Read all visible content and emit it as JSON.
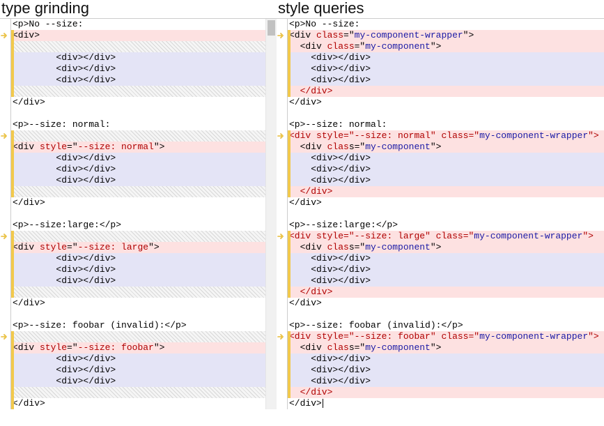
{
  "left": {
    "title": "type grinding",
    "lines": [
      {
        "hl": "",
        "bar": false,
        "arrow": false,
        "tokens": [
          {
            "t": "<p>No --size:",
            "c": "t-blk"
          }
        ]
      },
      {
        "hl": "hl-red",
        "bar": true,
        "arrow": true,
        "tokens": [
          {
            "t": "<div>",
            "c": "t-blk"
          }
        ]
      },
      {
        "hl": "hl-hatch",
        "bar": true,
        "arrow": false,
        "tokens": [
          {
            "t": "",
            "c": ""
          }
        ]
      },
      {
        "hl": "hl-blue",
        "bar": true,
        "arrow": false,
        "tokens": [
          {
            "t": "        <div></div>",
            "c": "t-blk"
          }
        ]
      },
      {
        "hl": "hl-blue",
        "bar": true,
        "arrow": false,
        "tokens": [
          {
            "t": "        <div></div>",
            "c": "t-blk"
          }
        ]
      },
      {
        "hl": "hl-blue",
        "bar": true,
        "arrow": false,
        "tokens": [
          {
            "t": "        <div></div>",
            "c": "t-blk"
          }
        ]
      },
      {
        "hl": "hl-hatch",
        "bar": true,
        "arrow": false,
        "tokens": [
          {
            "t": "",
            "c": ""
          }
        ]
      },
      {
        "hl": "",
        "bar": false,
        "arrow": false,
        "tokens": [
          {
            "t": "</div>",
            "c": "t-blk"
          }
        ]
      },
      {
        "hl": "",
        "bar": false,
        "arrow": false,
        "tokens": [
          {
            "t": "",
            "c": ""
          }
        ]
      },
      {
        "hl": "",
        "bar": false,
        "arrow": false,
        "tokens": [
          {
            "t": "<p>--size: normal:",
            "c": "t-blk"
          }
        ]
      },
      {
        "hl": "hl-hatch",
        "bar": true,
        "arrow": true,
        "tokens": [
          {
            "t": "",
            "c": ""
          }
        ]
      },
      {
        "hl": "hl-red",
        "bar": true,
        "arrow": false,
        "tokens": [
          {
            "t": "<div ",
            "c": "t-blk"
          },
          {
            "t": "style",
            "c": "t-attr"
          },
          {
            "t": "=\"",
            "c": "t-blk"
          },
          {
            "t": "--size: normal",
            "c": "t-attr"
          },
          {
            "t": "\">",
            "c": "t-blk"
          }
        ]
      },
      {
        "hl": "hl-blue",
        "bar": true,
        "arrow": false,
        "tokens": [
          {
            "t": "        <div></div>",
            "c": "t-blk"
          }
        ]
      },
      {
        "hl": "hl-blue",
        "bar": true,
        "arrow": false,
        "tokens": [
          {
            "t": "        <div></div>",
            "c": "t-blk"
          }
        ]
      },
      {
        "hl": "hl-blue",
        "bar": true,
        "arrow": false,
        "tokens": [
          {
            "t": "        <div></div>",
            "c": "t-blk"
          }
        ]
      },
      {
        "hl": "hl-hatch",
        "bar": true,
        "arrow": false,
        "tokens": [
          {
            "t": "",
            "c": ""
          }
        ]
      },
      {
        "hl": "",
        "bar": false,
        "arrow": false,
        "tokens": [
          {
            "t": "</div>",
            "c": "t-blk"
          }
        ]
      },
      {
        "hl": "",
        "bar": false,
        "arrow": false,
        "tokens": [
          {
            "t": "",
            "c": ""
          }
        ]
      },
      {
        "hl": "",
        "bar": false,
        "arrow": false,
        "tokens": [
          {
            "t": "<p>--size:large:</p>",
            "c": "t-blk"
          }
        ]
      },
      {
        "hl": "hl-hatch",
        "bar": true,
        "arrow": true,
        "tokens": [
          {
            "t": "",
            "c": ""
          }
        ]
      },
      {
        "hl": "hl-red",
        "bar": true,
        "arrow": false,
        "tokens": [
          {
            "t": "<div ",
            "c": "t-blk"
          },
          {
            "t": "style",
            "c": "t-attr"
          },
          {
            "t": "=\"",
            "c": "t-blk"
          },
          {
            "t": "--size: large",
            "c": "t-attr"
          },
          {
            "t": "\">",
            "c": "t-blk"
          }
        ]
      },
      {
        "hl": "hl-blue",
        "bar": true,
        "arrow": false,
        "tokens": [
          {
            "t": "        <div></div>",
            "c": "t-blk"
          }
        ]
      },
      {
        "hl": "hl-blue",
        "bar": true,
        "arrow": false,
        "tokens": [
          {
            "t": "        <div></div>",
            "c": "t-blk"
          }
        ]
      },
      {
        "hl": "hl-blue",
        "bar": true,
        "arrow": false,
        "tokens": [
          {
            "t": "        <div></div>",
            "c": "t-blk"
          }
        ]
      },
      {
        "hl": "hl-hatch",
        "bar": true,
        "arrow": false,
        "tokens": [
          {
            "t": "",
            "c": ""
          }
        ]
      },
      {
        "hl": "",
        "bar": false,
        "arrow": false,
        "tokens": [
          {
            "t": "</div>",
            "c": "t-blk"
          }
        ]
      },
      {
        "hl": "",
        "bar": false,
        "arrow": false,
        "tokens": [
          {
            "t": "",
            "c": ""
          }
        ]
      },
      {
        "hl": "",
        "bar": false,
        "arrow": false,
        "tokens": [
          {
            "t": "<p>--size: foobar (invalid):</p>",
            "c": "t-blk"
          }
        ]
      },
      {
        "hl": "hl-hatch",
        "bar": true,
        "arrow": true,
        "tokens": [
          {
            "t": "",
            "c": ""
          }
        ]
      },
      {
        "hl": "hl-red",
        "bar": true,
        "arrow": false,
        "tokens": [
          {
            "t": "<div ",
            "c": "t-blk"
          },
          {
            "t": "style",
            "c": "t-attr"
          },
          {
            "t": "=\"",
            "c": "t-blk"
          },
          {
            "t": "--size: foobar",
            "c": "t-attr"
          },
          {
            "t": "\">",
            "c": "t-blk"
          }
        ]
      },
      {
        "hl": "hl-blue",
        "bar": true,
        "arrow": false,
        "tokens": [
          {
            "t": "        <div></div>",
            "c": "t-blk"
          }
        ]
      },
      {
        "hl": "hl-blue",
        "bar": true,
        "arrow": false,
        "tokens": [
          {
            "t": "        <div></div>",
            "c": "t-blk"
          }
        ]
      },
      {
        "hl": "hl-blue",
        "bar": true,
        "arrow": false,
        "tokens": [
          {
            "t": "        <div></div>",
            "c": "t-blk"
          }
        ]
      },
      {
        "hl": "hl-hatch",
        "bar": true,
        "arrow": false,
        "tokens": [
          {
            "t": "",
            "c": ""
          }
        ]
      },
      {
        "hl": "",
        "bar": true,
        "arrow": false,
        "tokens": [
          {
            "t": "</div>",
            "c": "t-blk"
          }
        ]
      }
    ]
  },
  "right": {
    "title": "style queries",
    "lines": [
      {
        "hl": "",
        "bar": false,
        "arrow": false,
        "tokens": [
          {
            "t": "<p>No --size:",
            "c": "t-blk"
          }
        ]
      },
      {
        "hl": "hl-red",
        "bar": true,
        "arrow": true,
        "tokens": [
          {
            "t": "<div ",
            "c": "t-blk"
          },
          {
            "t": "class",
            "c": "t-attr"
          },
          {
            "t": "=\"",
            "c": "t-blk"
          },
          {
            "t": "my-component-wrapper",
            "c": "t-str"
          },
          {
            "t": "\">",
            "c": "t-blk"
          }
        ]
      },
      {
        "hl": "hl-red",
        "bar": true,
        "arrow": false,
        "tokens": [
          {
            "t": "  <div ",
            "c": "t-blk"
          },
          {
            "t": "class",
            "c": "t-attr"
          },
          {
            "t": "=\"",
            "c": "t-blk"
          },
          {
            "t": "my-component",
            "c": "t-str"
          },
          {
            "t": "\">",
            "c": "t-blk"
          }
        ]
      },
      {
        "hl": "hl-blue",
        "bar": true,
        "arrow": false,
        "tokens": [
          {
            "t": "    <div></div>",
            "c": "t-blk"
          }
        ]
      },
      {
        "hl": "hl-blue",
        "bar": true,
        "arrow": false,
        "tokens": [
          {
            "t": "    <div></div>",
            "c": "t-blk"
          }
        ]
      },
      {
        "hl": "hl-blue",
        "bar": true,
        "arrow": false,
        "tokens": [
          {
            "t": "    <div></div>",
            "c": "t-blk"
          }
        ]
      },
      {
        "hl": "hl-red",
        "bar": true,
        "arrow": false,
        "tokens": [
          {
            "t": "  </div>",
            "c": "t-red"
          }
        ]
      },
      {
        "hl": "",
        "bar": false,
        "arrow": false,
        "tokens": [
          {
            "t": "</div>",
            "c": "t-blk"
          }
        ]
      },
      {
        "hl": "",
        "bar": false,
        "arrow": false,
        "tokens": [
          {
            "t": "",
            "c": ""
          }
        ]
      },
      {
        "hl": "",
        "bar": false,
        "arrow": false,
        "tokens": [
          {
            "t": "<p>--size: normal:",
            "c": "t-blk"
          }
        ]
      },
      {
        "hl": "hl-red",
        "bar": true,
        "arrow": true,
        "tokens": [
          {
            "t": "<div ",
            "c": "t-red"
          },
          {
            "t": "style",
            "c": "t-attr"
          },
          {
            "t": "=\"",
            "c": "t-red"
          },
          {
            "t": "--size: normal",
            "c": "t-attr"
          },
          {
            "t": "\" ",
            "c": "t-red"
          },
          {
            "t": "class",
            "c": "t-attr"
          },
          {
            "t": "=\"",
            "c": "t-red"
          },
          {
            "t": "my-component-wrapper",
            "c": "t-str"
          },
          {
            "t": "\">",
            "c": "t-red"
          }
        ]
      },
      {
        "hl": "hl-red",
        "bar": true,
        "arrow": false,
        "tokens": [
          {
            "t": "  <div ",
            "c": "t-blk"
          },
          {
            "t": "clas",
            "c": "t-attr"
          },
          {
            "t": "s=\"",
            "c": "t-blk"
          },
          {
            "t": "my-component",
            "c": "t-str"
          },
          {
            "t": "\">",
            "c": "t-blk"
          }
        ]
      },
      {
        "hl": "hl-blue",
        "bar": true,
        "arrow": false,
        "tokens": [
          {
            "t": "    <div></div>",
            "c": "t-blk"
          }
        ]
      },
      {
        "hl": "hl-blue",
        "bar": true,
        "arrow": false,
        "tokens": [
          {
            "t": "    <div></div>",
            "c": "t-blk"
          }
        ]
      },
      {
        "hl": "hl-blue",
        "bar": true,
        "arrow": false,
        "tokens": [
          {
            "t": "    <div></div>",
            "c": "t-blk"
          }
        ]
      },
      {
        "hl": "hl-red",
        "bar": true,
        "arrow": false,
        "tokens": [
          {
            "t": "  </div>",
            "c": "t-red"
          }
        ]
      },
      {
        "hl": "",
        "bar": false,
        "arrow": false,
        "tokens": [
          {
            "t": "</div>",
            "c": "t-blk"
          }
        ]
      },
      {
        "hl": "",
        "bar": false,
        "arrow": false,
        "tokens": [
          {
            "t": "",
            "c": ""
          }
        ]
      },
      {
        "hl": "",
        "bar": false,
        "arrow": false,
        "tokens": [
          {
            "t": "<p>--size:large:</p>",
            "c": "t-blk"
          }
        ]
      },
      {
        "hl": "hl-red",
        "bar": true,
        "arrow": true,
        "tokens": [
          {
            "t": "<div ",
            "c": "t-red"
          },
          {
            "t": "style",
            "c": "t-attr"
          },
          {
            "t": "=\"",
            "c": "t-red"
          },
          {
            "t": "--size: large",
            "c": "t-attr"
          },
          {
            "t": "\" ",
            "c": "t-red"
          },
          {
            "t": "class",
            "c": "t-attr"
          },
          {
            "t": "=\"",
            "c": "t-red"
          },
          {
            "t": "my-component-wrapper",
            "c": "t-str"
          },
          {
            "t": "\">",
            "c": "t-red"
          }
        ]
      },
      {
        "hl": "hl-red",
        "bar": true,
        "arrow": false,
        "tokens": [
          {
            "t": "  <div ",
            "c": "t-blk"
          },
          {
            "t": "clas",
            "c": "t-attr"
          },
          {
            "t": "s=\"",
            "c": "t-blk"
          },
          {
            "t": "my-component",
            "c": "t-str"
          },
          {
            "t": "\">",
            "c": "t-blk"
          }
        ]
      },
      {
        "hl": "hl-blue",
        "bar": true,
        "arrow": false,
        "tokens": [
          {
            "t": "    <div></div>",
            "c": "t-blk"
          }
        ]
      },
      {
        "hl": "hl-blue",
        "bar": true,
        "arrow": false,
        "tokens": [
          {
            "t": "    <div></div>",
            "c": "t-blk"
          }
        ]
      },
      {
        "hl": "hl-blue",
        "bar": true,
        "arrow": false,
        "tokens": [
          {
            "t": "    <div></div>",
            "c": "t-blk"
          }
        ]
      },
      {
        "hl": "hl-red",
        "bar": true,
        "arrow": false,
        "tokens": [
          {
            "t": "  </div>",
            "c": "t-red"
          }
        ]
      },
      {
        "hl": "",
        "bar": false,
        "arrow": false,
        "tokens": [
          {
            "t": "</div>",
            "c": "t-blk"
          }
        ]
      },
      {
        "hl": "",
        "bar": false,
        "arrow": false,
        "tokens": [
          {
            "t": "",
            "c": ""
          }
        ]
      },
      {
        "hl": "",
        "bar": false,
        "arrow": false,
        "tokens": [
          {
            "t": "<p>--size: foobar (invalid):</p>",
            "c": "t-blk"
          }
        ]
      },
      {
        "hl": "hl-red",
        "bar": true,
        "arrow": true,
        "tokens": [
          {
            "t": "<div ",
            "c": "t-red"
          },
          {
            "t": "style",
            "c": "t-attr"
          },
          {
            "t": "=\"",
            "c": "t-red"
          },
          {
            "t": "--size: foobar",
            "c": "t-attr"
          },
          {
            "t": "\" ",
            "c": "t-red"
          },
          {
            "t": "class",
            "c": "t-attr"
          },
          {
            "t": "=\"",
            "c": "t-red"
          },
          {
            "t": "my-component-wrapper",
            "c": "t-str"
          },
          {
            "t": "\">",
            "c": "t-red"
          }
        ]
      },
      {
        "hl": "hl-red",
        "bar": true,
        "arrow": false,
        "tokens": [
          {
            "t": "  <div ",
            "c": "t-blk"
          },
          {
            "t": "clas",
            "c": "t-attr"
          },
          {
            "t": "s=\"",
            "c": "t-blk"
          },
          {
            "t": "my-component",
            "c": "t-str"
          },
          {
            "t": "\">",
            "c": "t-blk"
          }
        ]
      },
      {
        "hl": "hl-blue",
        "bar": true,
        "arrow": false,
        "tokens": [
          {
            "t": "    <div></div>",
            "c": "t-blk"
          }
        ]
      },
      {
        "hl": "hl-blue",
        "bar": true,
        "arrow": false,
        "tokens": [
          {
            "t": "    <div></div>",
            "c": "t-blk"
          }
        ]
      },
      {
        "hl": "hl-blue",
        "bar": true,
        "arrow": false,
        "tokens": [
          {
            "t": "    <div></div>",
            "c": "t-blk"
          }
        ]
      },
      {
        "hl": "hl-red",
        "bar": true,
        "arrow": false,
        "tokens": [
          {
            "t": "  </div>",
            "c": "t-red"
          }
        ]
      },
      {
        "hl": "",
        "bar": false,
        "arrow": false,
        "cursor": true,
        "tokens": [
          {
            "t": "</div>",
            "c": "t-blk"
          }
        ]
      }
    ]
  }
}
